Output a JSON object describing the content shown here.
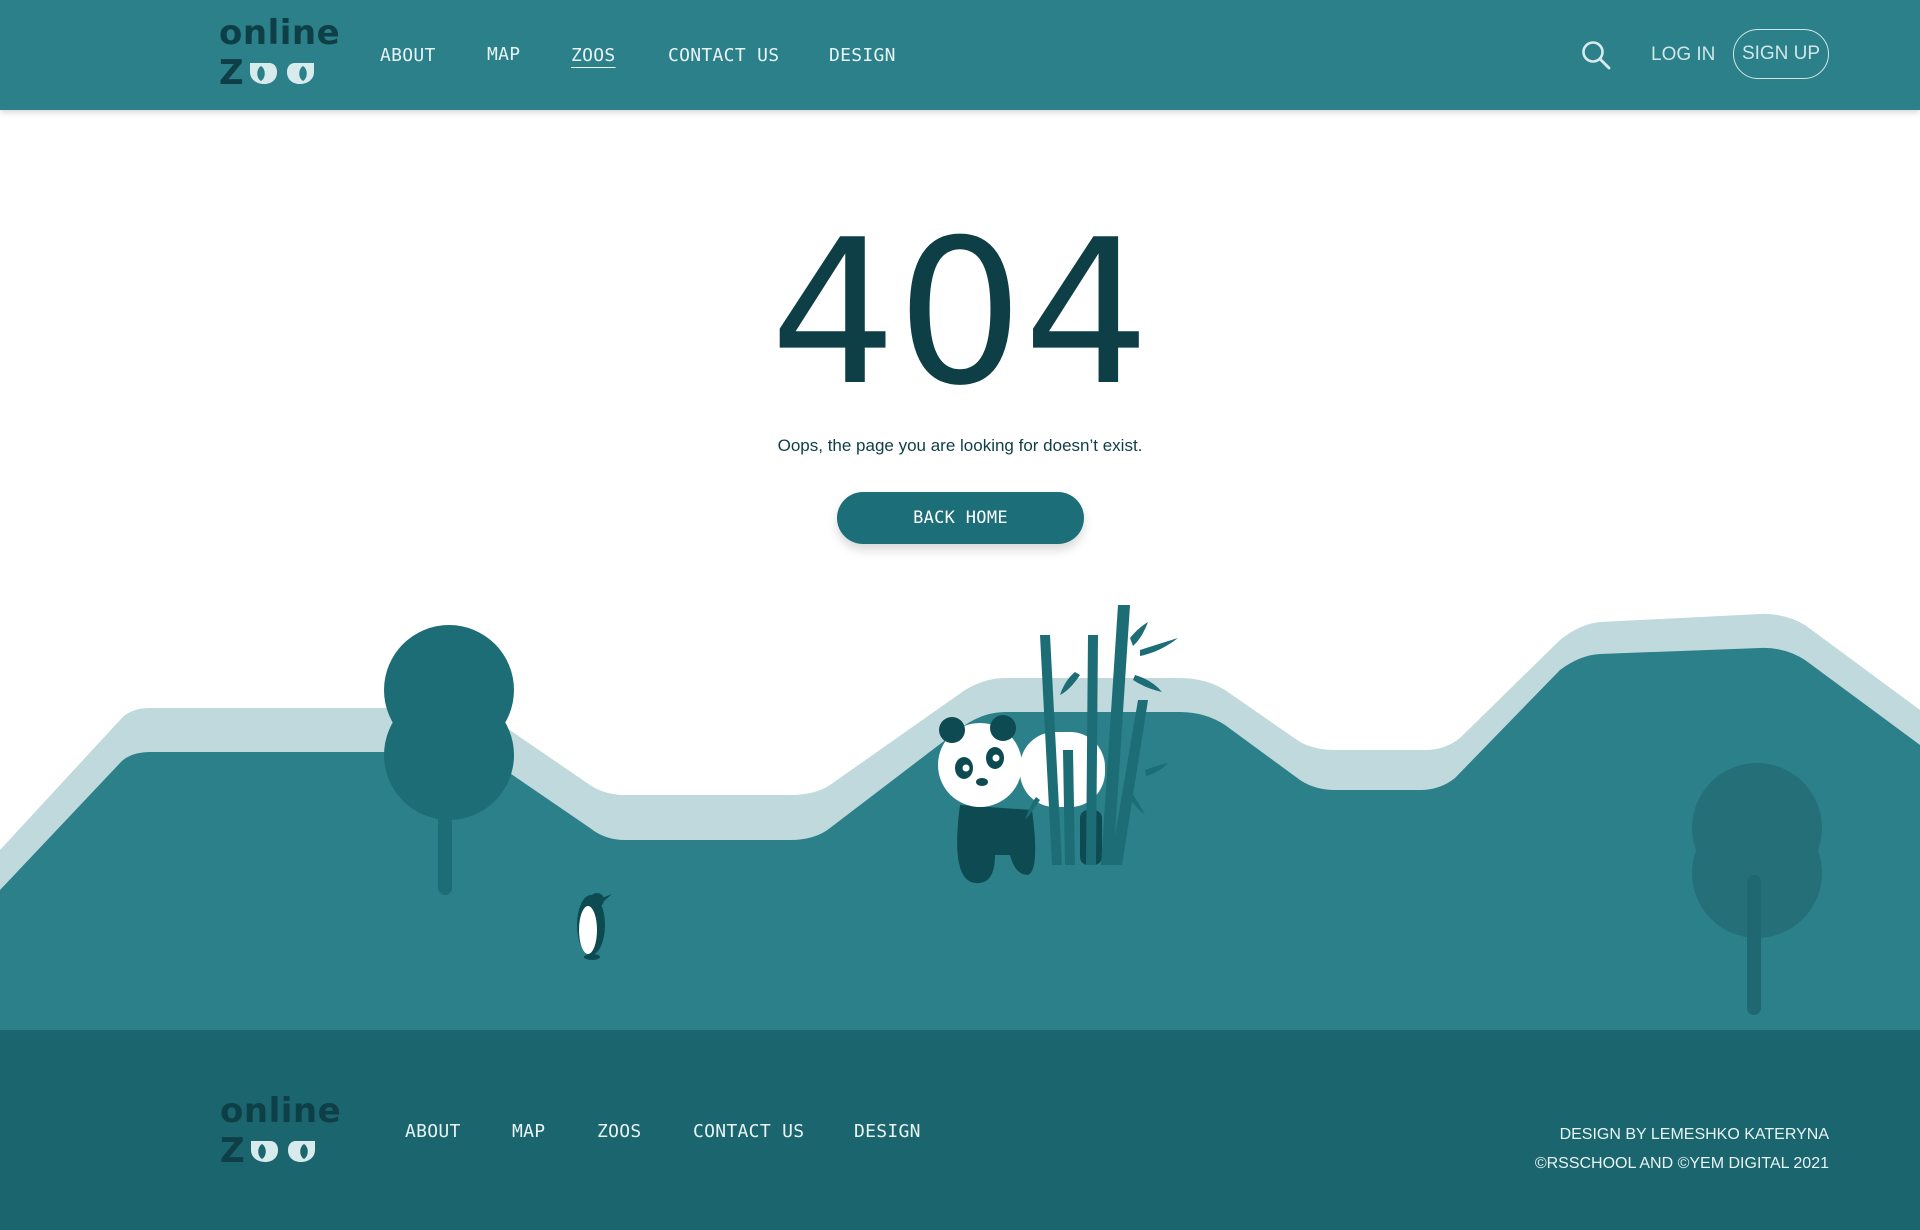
{
  "header": {
    "logo": {
      "word": "online",
      "z_letter": "Z"
    },
    "nav": [
      {
        "label": "ABOUT",
        "active": false
      },
      {
        "label": "MAP",
        "active": false
      },
      {
        "label": "ZOOS",
        "active": true
      },
      {
        "label": "CONTACT US",
        "active": false
      },
      {
        "label": "DESIGN",
        "active": false
      }
    ],
    "search_icon": "search-icon",
    "login_label": "LOG IN",
    "signup_label": "SIGN UP"
  },
  "main": {
    "code": "404",
    "message": "Oops, the page you are looking for doesn’t exist.",
    "back_label": "BACK HOME"
  },
  "footer": {
    "logo": {
      "word": "online",
      "z_letter": "Z"
    },
    "nav": [
      {
        "label": "ABOUT"
      },
      {
        "label": "MAP"
      },
      {
        "label": "ZOOS"
      },
      {
        "label": "CONTACT US"
      },
      {
        "label": "DESIGN"
      }
    ],
    "credit_design": "DESIGN BY LEMESHKO KATERYNA",
    "credit_copyright": "©RSSCHOOL AND ©YEM DIGITAL 2021"
  },
  "colors": {
    "header_bg": "#2c8089",
    "footer_bg": "#1b666e",
    "dark_teal": "#0e3e46",
    "button": "#1c6f79",
    "hill": "#2c8089",
    "hill_edge": "#c0d9dc"
  }
}
